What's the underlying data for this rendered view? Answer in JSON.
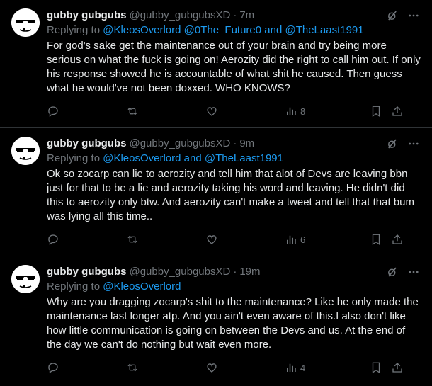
{
  "colors": {
    "background": "#000000",
    "text": "#e7e9ea",
    "muted": "#71767b",
    "mention": "#1d9bf0",
    "divider": "#2f3336"
  },
  "tweets": [
    {
      "name": "gubby gubgubs",
      "handle": "@gubby_gubgubsXD",
      "separator": "·",
      "time": "7m",
      "reply_prefix": "Replying to ",
      "reply_mentions": "@KleosOverlord @0The_Future0 and @TheLaast1991",
      "body": "For god's sake get the maintenance out of your brain and try being more serious on what the fuck is going on! Aerozity did the right to call him out. If only his response showed he is accountable of what shit he caused. Then guess what he would've not been doxxed. WHO KNOWS?",
      "views": "8"
    },
    {
      "name": "gubby gubgubs",
      "handle": "@gubby_gubgubsXD",
      "separator": "·",
      "time": "9m",
      "reply_prefix": "Replying to ",
      "reply_mentions": "@KleosOverlord and @TheLaast1991",
      "body": "Ok so zocarp can lie to aerozity and tell him that alot of Devs are leaving bbn just for that to be a lie and aerozity taking his word and leaving. He didn't did this to aerozity only btw.  And aerozity can't make a tweet and tell that that bum was lying all this time..",
      "views": "6"
    },
    {
      "name": "gubby gubgubs",
      "handle": "@gubby_gubgubsXD",
      "separator": "·",
      "time": "19m",
      "reply_prefix": "Replying to ",
      "reply_mentions": "@KleosOverlord",
      "body": "Why are you dragging zocarp's shit to the maintenance? Like he only made the maintenance last longer atp. And you ain't even aware of this.I also don't like how little communication is going on between the Devs and us. At the end of the day we can't do nothing but wait even more.",
      "views": "4"
    }
  ],
  "icons": {
    "reply": "reply-icon",
    "retweet": "retweet-icon",
    "like": "like-icon",
    "views": "views-icon",
    "bookmark": "bookmark-icon",
    "share": "share-icon",
    "grok": "grok-icon",
    "more": "more-icon"
  }
}
